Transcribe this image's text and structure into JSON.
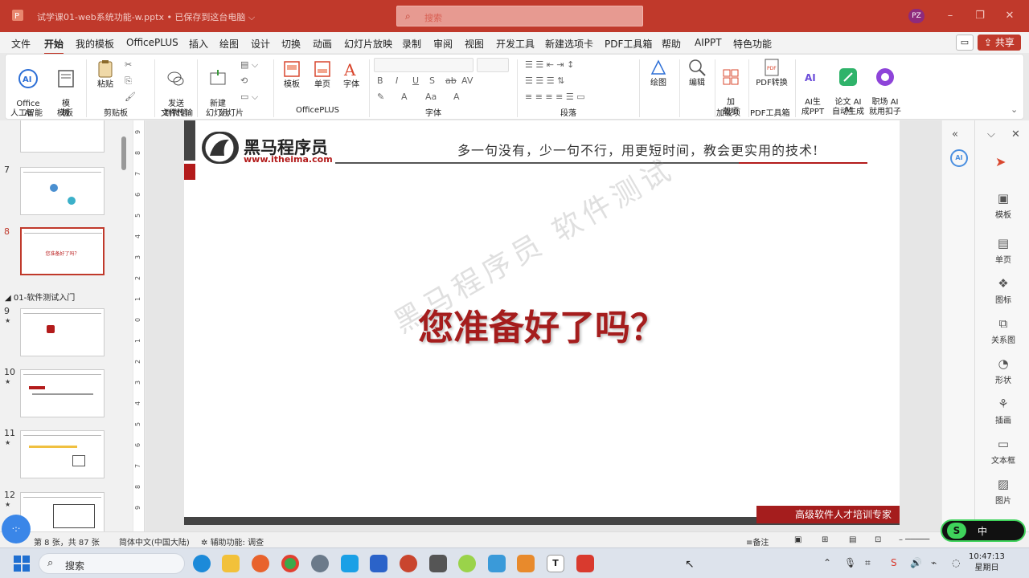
{
  "window": {
    "doc_title": "试学课01-web系统功能-w.pptx • 已保存到这台电脑 ⌵",
    "search_placeholder": "搜索",
    "avatar": "PZ"
  },
  "menu": {
    "tabs": [
      "文件",
      "开始",
      "我的模板",
      "OfficePLUS",
      "插入",
      "绘图",
      "设计",
      "切换",
      "动画",
      "幻灯片放映",
      "录制",
      "审阅",
      "视图",
      "开发工具",
      "新建选项卡",
      "PDF工具箱",
      "帮助",
      "AIPPT",
      "特色功能"
    ],
    "active_tab": "开始",
    "share_label": "共享"
  },
  "ribbon": {
    "office_ai": "Office\nAI",
    "template": "模\n板",
    "paste": "粘贴",
    "send_wechat": "发送\n到微信",
    "new_slide": "新建\n幻灯片",
    "templates2": "模板",
    "single_page": "单页",
    "font_btn": "字体",
    "draw": "绘图",
    "edit": "编辑",
    "addins": "加\n载项",
    "pdf_convert": "PDF转换",
    "ai_ppt": "AI生\n成PPT",
    "paper_ai": "论文 AI\n自动生成",
    "career_ai": "职场 AI\n就用扣子",
    "groups": {
      "ai_label": "人工智能",
      "template_label": "模板",
      "clipboard_label": "剪贴板",
      "transfer_label": "文件传输",
      "slides_label": "幻灯片",
      "officeplus_label": "OfficePLUS",
      "font_label": "字体",
      "paragraph_label": "段落",
      "addins_label": "加载项",
      "pdf_label": "PDF工具箱",
      "ai2_label": "AI"
    }
  },
  "thumbnails": {
    "section_title": "01-软件测试入门",
    "slides": [
      {
        "num": "7",
        "star": "",
        "text": ""
      },
      {
        "num": "8",
        "star": "",
        "text": "您准备好了吗？"
      },
      {
        "num": "9",
        "star": "★",
        "text": ""
      },
      {
        "num": "10",
        "star": "★",
        "text": ""
      },
      {
        "num": "11",
        "star": "★",
        "text": ""
      },
      {
        "num": "12",
        "star": "★",
        "text": ""
      }
    ]
  },
  "slide": {
    "brand_name": "黑马程序员",
    "brand_url": "www.itheima.com",
    "slogan": "多一句没有，少一句不行，用更短时间，教会更实用的技术!",
    "main_question": "您准备好了吗？",
    "watermark": "黑马程序员 软件测试",
    "footer_tag": "高级软件人才培训专家"
  },
  "right_panel": {
    "tools": [
      "模板",
      "单页",
      "图标",
      "关系图",
      "形状",
      "插画",
      "文本框",
      "图片"
    ]
  },
  "status": {
    "slide_info": "第 8 张，共 87 张",
    "language": "简体中文(中国大陆)",
    "accessibility": "辅助功能: 调查",
    "notes": "备注"
  },
  "taskbar": {
    "search": "搜索",
    "time": "10:47:13",
    "day": "星期日"
  },
  "ime": {
    "mode": "中"
  },
  "colors": {
    "accent": "#c0392b",
    "slide_red": "#a51d1d"
  }
}
